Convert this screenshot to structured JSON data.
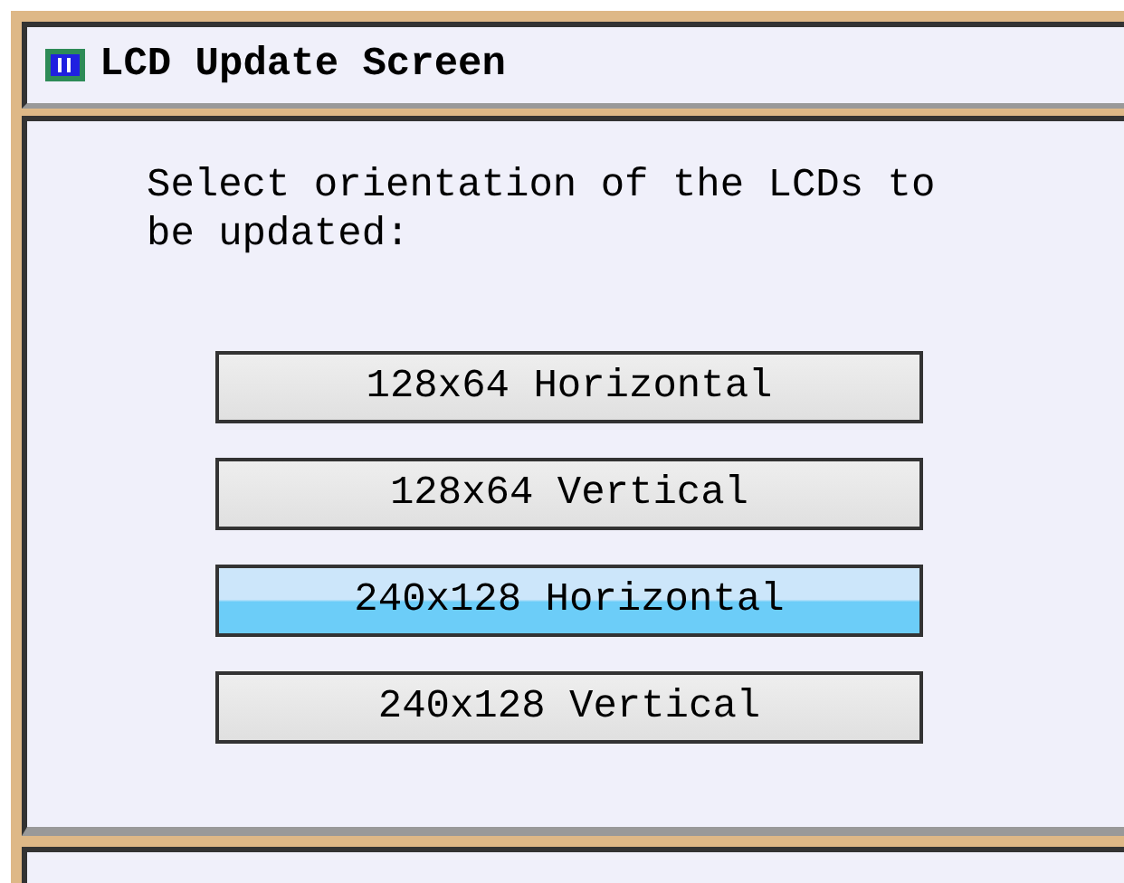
{
  "window": {
    "title": "LCD Update Screen"
  },
  "prompt": "Select orientation of the LCDs to be updated:",
  "options": [
    {
      "label": "128x64 Horizontal",
      "selected": false
    },
    {
      "label": "128x64 Vertical",
      "selected": false
    },
    {
      "label": "240x128 Horizontal",
      "selected": true
    },
    {
      "label": "240x128 Vertical",
      "selected": false
    }
  ]
}
